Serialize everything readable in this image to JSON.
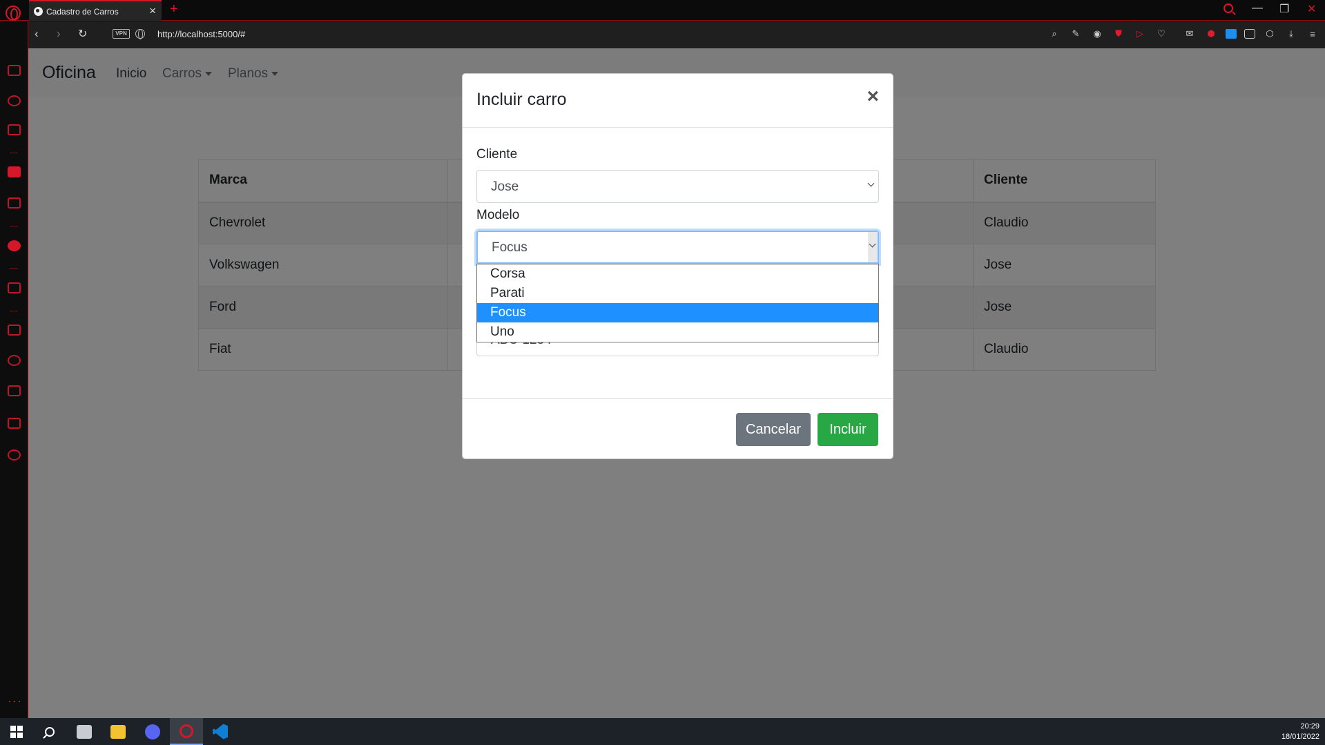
{
  "browser": {
    "tab_title": "Cadastro de Carros",
    "tab_close": "×",
    "new_tab": "+",
    "vpn_label": "VPN",
    "url": "http://localhost:5000/#",
    "accent_color": "#d6172a"
  },
  "navbar": {
    "brand": "Oficina",
    "links": [
      {
        "label": "Inicio"
      },
      {
        "label": "Carros"
      },
      {
        "label": "Planos"
      }
    ]
  },
  "table": {
    "headers": [
      "Marca",
      "",
      "",
      "Cliente"
    ],
    "rows": [
      {
        "marca": "Chevrolet",
        "cliente": "Claudio"
      },
      {
        "marca": "Volkswagen",
        "cliente": "Jose"
      },
      {
        "marca": "Ford",
        "cliente": "Jose"
      },
      {
        "marca": "Fiat",
        "cliente": "Claudio"
      }
    ]
  },
  "modal": {
    "title": "Incluir carro",
    "close": "×",
    "cliente_label": "Cliente",
    "cliente_value": "Jose",
    "modelo_label": "Modelo",
    "modelo_value": "Focus",
    "modelo_options": [
      "Corsa",
      "Parati",
      "Focus",
      "Uno"
    ],
    "modelo_selected_index": 2,
    "placa_value": "ABC-1234",
    "cancel_label": "Cancelar",
    "submit_label": "Incluir"
  },
  "taskbar": {
    "time": "20:29",
    "date": "18/01/2022"
  }
}
